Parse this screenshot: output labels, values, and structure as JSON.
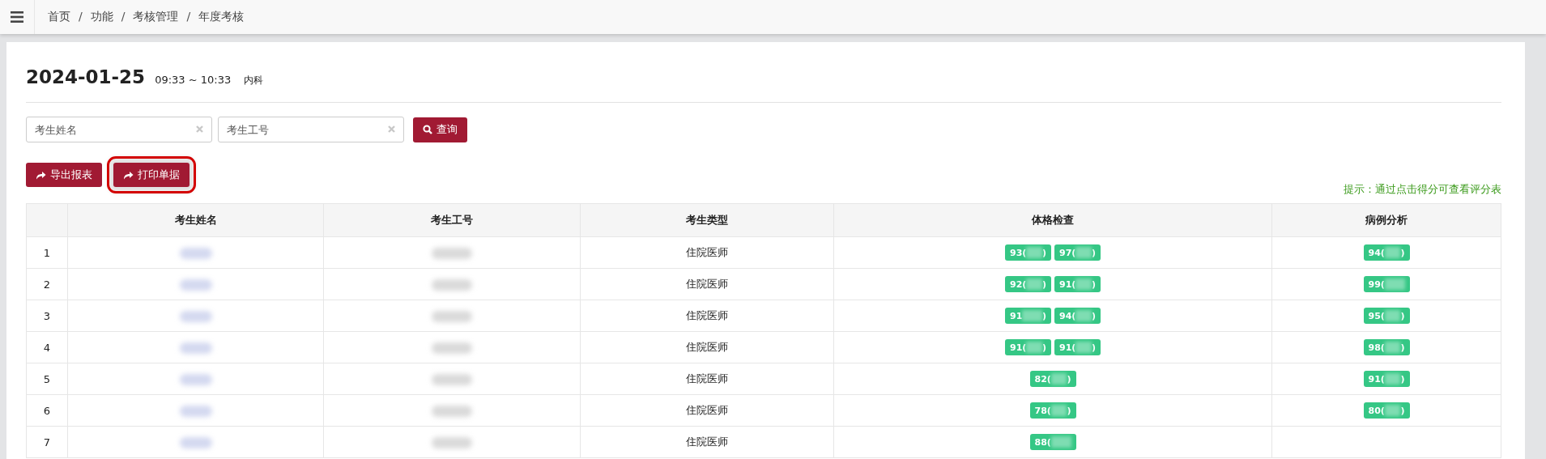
{
  "breadcrumb": [
    "首页",
    "功能",
    "考核管理",
    "年度考核"
  ],
  "breadcrumb_separator": "/",
  "header": {
    "date": "2024-01-25",
    "time": "09:33 ~ 10:33",
    "department": "内科"
  },
  "filters": [
    {
      "placeholder": "考生姓名"
    },
    {
      "placeholder": "考生工号"
    }
  ],
  "search_button": "查询",
  "actions": [
    {
      "label": "导出报表",
      "highlighted": false
    },
    {
      "label": "打印单据",
      "highlighted": true
    }
  ],
  "hint": "提示：通过点击得分可查看评分表",
  "table": {
    "columns": [
      "",
      "考生姓名",
      "考生工号",
      "考生类型",
      "体格检查",
      "病例分析"
    ],
    "rows": [
      {
        "index": "1",
        "type": "住院医师",
        "physical": [
          {
            "text": "93(",
            "end": ")"
          },
          {
            "text": "97(",
            "end": ")"
          }
        ],
        "case": [
          {
            "text": "94(",
            "end": ")"
          }
        ]
      },
      {
        "index": "2",
        "type": "住院医师",
        "physical": [
          {
            "text": "92(",
            "end": ")"
          },
          {
            "text": "91(",
            "end": ")"
          }
        ],
        "case": [
          {
            "text": "99("
          }
        ]
      },
      {
        "index": "3",
        "type": "住院医师",
        "physical": [
          {
            "text": "91",
            "end": ")"
          },
          {
            "text": "94(",
            "end": ")"
          }
        ],
        "case": [
          {
            "text": "95(",
            "end": ")"
          }
        ]
      },
      {
        "index": "4",
        "type": "住院医师",
        "physical": [
          {
            "text": "91(",
            "end": ")"
          },
          {
            "text": "91(",
            "end": ")"
          }
        ],
        "case": [
          {
            "text": "98(",
            "end": ")"
          }
        ]
      },
      {
        "index": "5",
        "type": "住院医师",
        "physical": [
          {
            "text": "82(",
            "end": ")"
          }
        ],
        "case": [
          {
            "text": "91(",
            "end": ")"
          }
        ]
      },
      {
        "index": "6",
        "type": "住院医师",
        "physical": [
          {
            "text": "78(",
            "end": ")"
          }
        ],
        "case": [
          {
            "text": "80(",
            "end": ")"
          }
        ]
      },
      {
        "index": "7",
        "type": "住院医师",
        "physical": [
          {
            "text": "88("
          }
        ],
        "case": []
      }
    ]
  }
}
